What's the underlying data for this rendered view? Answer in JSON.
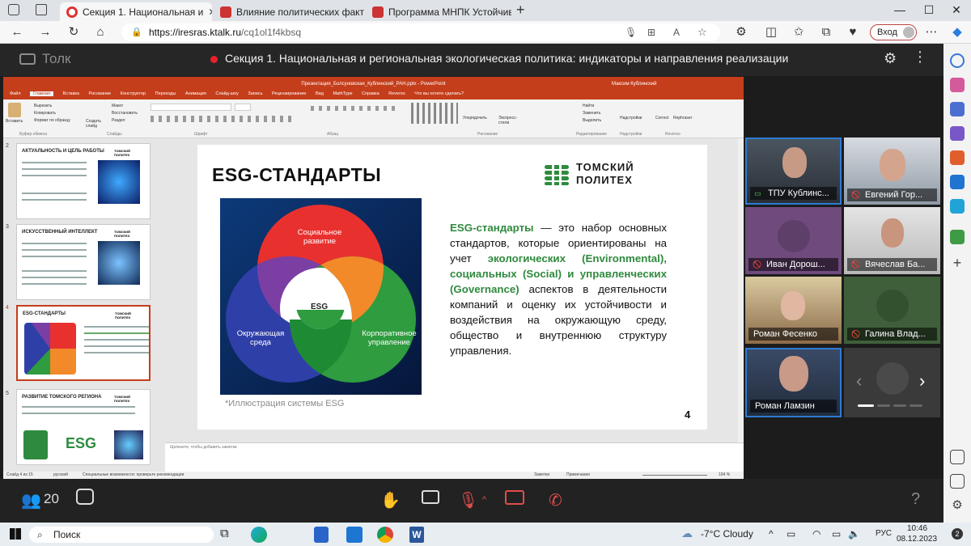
{
  "browser": {
    "tabs": [
      {
        "label": "Секция 1. Национальная и",
        "active": true
      },
      {
        "label": "Влияние политических факторо",
        "active": false
      },
      {
        "label": "Программа МНПК Устойчивое",
        "active": false
      }
    ],
    "url_host": "https://iresras.ktalk.ru",
    "url_path": "/cq1ol1f4kbsq",
    "login_label": "Вход"
  },
  "meeting": {
    "logo": "Толк",
    "title": "Секция 1. Национальная и региональная экологическая политика: индикаторы и направления реализации",
    "participants_count": "20"
  },
  "powerpoint": {
    "window_title": "Презентация_Болсуновская_Кублинский_РАН.pptx - PowerPoint",
    "user": "Максим Кублинский",
    "menu": [
      "Файл",
      "Главная",
      "Вставка",
      "Рисование",
      "Конструктор",
      "Переходы",
      "Анимация",
      "Слайд-шоу",
      "Запись",
      "Рецензирование",
      "Вид",
      "MathType",
      "Справка",
      "Reverso",
      "Что вы хотите сделать?"
    ],
    "ribbon_groups": [
      "Буфер обмена",
      "Слайды",
      "Шрифт",
      "Абзац",
      "Рисование",
      "Редактирование",
      "Надстройки",
      "Reverso"
    ],
    "ribbon_left": [
      "Вставить",
      "Вырезать",
      "Копировать",
      "Формат по образцу",
      "Создать слайд",
      "Макет",
      "Восстановить",
      "Раздел"
    ],
    "ribbon_right": [
      "Найти",
      "Заменить",
      "Выделить",
      "Надстройки",
      "Correct",
      "Rephraser",
      "Упорядочить",
      "Экспресс-стили"
    ],
    "thumbnails": [
      {
        "num": "2",
        "title": "АКТУАЛЬНОСТЬ И ЦЕЛЬ РАБОТЫ"
      },
      {
        "num": "3",
        "title": "ИСКУССТВЕННЫЙ ИНТЕЛЛЕКТ"
      },
      {
        "num": "4",
        "title": "ESG-СТАНДАРТЫ"
      },
      {
        "num": "5",
        "title": "РАЗВИТИЕ ТОМСКОГО РЕГИОНА"
      }
    ],
    "thumb_logo": "ТОМСКИЙ ПОЛИТЕХ",
    "notes_placeholder": "Щелкните, чтобы добавить заметки",
    "status_left": "Слайд 4 из 15",
    "status_lang": "русский",
    "status_access": "Специальные возможности: проверьте рекомендации",
    "status_notes": "Заметки",
    "status_comments": "Примечания",
    "zoom": "104 %"
  },
  "slide": {
    "title": "ESG-СТАНДАРТЫ",
    "logo_line1": "ТОМСКИЙ",
    "logo_line2": "ПОЛИТЕХ",
    "venn_social": "Социальное развитие",
    "venn_env": "Окружающая среда",
    "venn_corp": "Корпоративное управление",
    "venn_center": "ESG",
    "body_1": "ESG-стандарты",
    "body_2": " — это набор основных стандартов, которые ориентированы на учет ",
    "body_3": "экологических (Environmental), социальных (Social) и управленческих (Governance)",
    "body_4": " аспектов в деятельности компаний и оценку их устойчивости и воздействия на окружающую среду, общество и внутреннюю структуру управления.",
    "caption": "*Иллюстрация системы ESG",
    "number": "4"
  },
  "participants": [
    {
      "name": "ТПУ Кублинс...",
      "speaking": true,
      "muted": false
    },
    {
      "name": "Евгений Гор...",
      "speaking": false,
      "muted": true
    },
    {
      "name": "Иван Дорош...",
      "speaking": false,
      "muted": true
    },
    {
      "name": "Вячеслав Ба...",
      "speaking": false,
      "muted": true
    },
    {
      "name": "Роман Фесенко",
      "speaking": false,
      "muted": false
    },
    {
      "name": "Галина Влад...",
      "speaking": false,
      "muted": true
    },
    {
      "name": "Роман Ламзин",
      "speaking": false,
      "muted": false
    }
  ],
  "taskbar": {
    "search": "Поиск",
    "weather": "-7°C  Cloudy",
    "lang": "РУС",
    "time": "10:46",
    "date": "08.12.2023"
  },
  "colors": {
    "ppt_red": "#c43e1c",
    "venn_red": "#e8312f",
    "venn_purple": "#7b3fa3",
    "venn_blue": "#2f3fa8",
    "venn_green": "#2e9c3f",
    "venn_yellow": "#f2d03a",
    "venn_orange": "#f28a2a",
    "esg_green": "#2f8a3e"
  }
}
